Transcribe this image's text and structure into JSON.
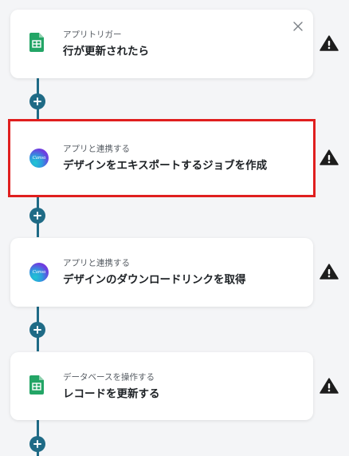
{
  "steps": [
    {
      "subtitle": "アプリトリガー",
      "title": "行が更新されたら",
      "app": "google-sheets"
    },
    {
      "subtitle": "アプリと連携する",
      "title": "デザインをエキスポートするジョブを作成",
      "app": "canva",
      "logo_text": "Canva"
    },
    {
      "subtitle": "アプリと連携する",
      "title": "デザインのダウンロードリンクを取得",
      "app": "canva",
      "logo_text": "Canva"
    },
    {
      "subtitle": "データベースを操作する",
      "title": "レコードを更新する",
      "app": "google-sheets"
    }
  ],
  "colors": {
    "connector": "#1f6b86",
    "selected_outline": "#e01f1f",
    "sheets_green": "#23a566",
    "warning": "#1d1d1d"
  },
  "icons": {
    "close": "close-icon",
    "add": "plus-icon",
    "warning": "warning-icon",
    "sheets": "google-sheets-icon",
    "canva": "canva-icon"
  }
}
